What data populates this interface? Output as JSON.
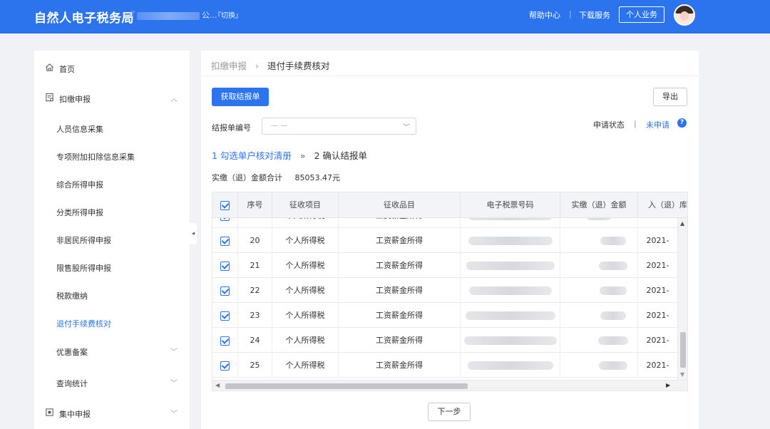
{
  "header": {
    "brand": "自然人电子税务局",
    "org_prefix": "『",
    "org_suffix": "公...",
    "switch_label": "『切换』",
    "help_center": "帮助中心",
    "separator": "|",
    "download": "下载服务",
    "personal": "个人业务"
  },
  "sidebar": {
    "items": [
      {
        "label": "首页",
        "icon": "home-icon"
      },
      {
        "label": "扣缴申报",
        "icon": "doc-icon",
        "expanded": true
      },
      {
        "label": "人员信息采集"
      },
      {
        "label": "专项附加扣除信息采集"
      },
      {
        "label": "综合所得申报"
      },
      {
        "label": "分类所得申报"
      },
      {
        "label": "非居民所得申报"
      },
      {
        "label": "限售股所得申报"
      },
      {
        "label": "税款缴纳"
      },
      {
        "label": "退付手续费核对",
        "active": true
      },
      {
        "label": "优惠备案"
      },
      {
        "label": "查询统计"
      },
      {
        "label": "集中申报",
        "icon": "box-icon"
      }
    ]
  },
  "breadcrumb": {
    "parent": "扣缴申报",
    "separator": "›",
    "current": "退付手续费核对"
  },
  "toolbar": {
    "fetch_label": "获取结报单",
    "export_label": "导出"
  },
  "filter": {
    "label": "结报单编号",
    "value": "— —"
  },
  "status": {
    "label": "申请状态",
    "separator": "|",
    "value": "未申请",
    "help": "?"
  },
  "steps": {
    "step1": "1 勾选单户核对清册",
    "arrow": "»",
    "step2": "2 确认结报单"
  },
  "summary": {
    "label": "实缴（退）金额合计",
    "amount": "85053.47元"
  },
  "table": {
    "headers": [
      "序号",
      "征收项目",
      "征收品目",
      "电子税票号码",
      "实缴（退）金额",
      "入（退）库"
    ],
    "rows": [
      {
        "no": "20",
        "item": "个人所得税",
        "category": "工资薪金所得",
        "date": "2021-"
      },
      {
        "no": "21",
        "item": "个人所得税",
        "category": "工资薪金所得",
        "date": "2021-"
      },
      {
        "no": "22",
        "item": "个人所得税",
        "category": "工资薪金所得",
        "date": "2021-"
      },
      {
        "no": "23",
        "item": "个人所得税",
        "category": "工资薪金所得",
        "date": "2021-"
      },
      {
        "no": "24",
        "item": "个人所得税",
        "category": "工资薪金所得",
        "date": "2021-"
      },
      {
        "no": "25",
        "item": "个人所得税",
        "category": "工资薪金所得",
        "date": "2021-"
      }
    ]
  },
  "footer": {
    "next_label": "下一步"
  },
  "colors": {
    "primary": "#2c74ee",
    "background": "#f1f2f6"
  }
}
